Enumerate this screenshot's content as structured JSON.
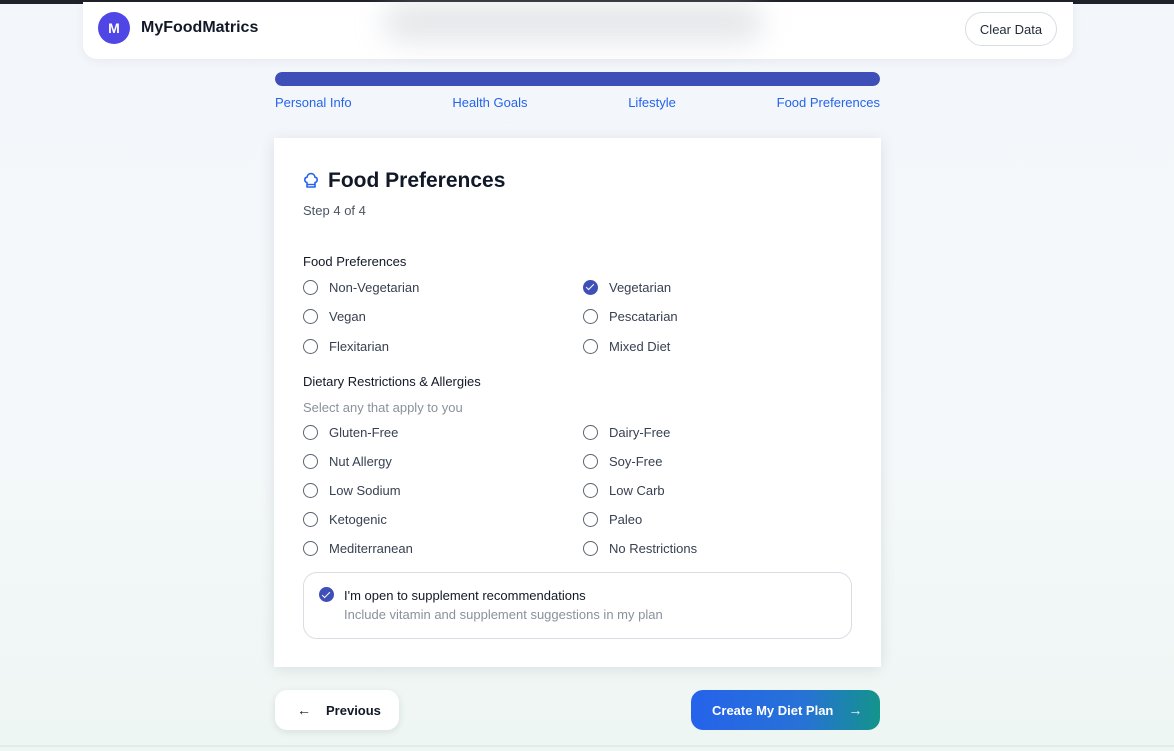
{
  "header": {
    "logo_letter": "M",
    "brand": "MyFoodMatrics",
    "clear_label": "Clear Data"
  },
  "progress": {
    "fraction": 1.0,
    "steps": [
      "Personal Info",
      "Health Goals",
      "Lifestyle",
      "Food Preferences"
    ]
  },
  "card": {
    "icon": "chef-hat-icon",
    "title": "Food Preferences",
    "subtitle": "Step 4 of 4",
    "preferences_title": "Food Preferences",
    "preferences": [
      {
        "label": "Non-Vegetarian",
        "checked": false
      },
      {
        "label": "Vegetarian",
        "checked": true
      },
      {
        "label": "Vegan",
        "checked": false
      },
      {
        "label": "Pescatarian",
        "checked": false
      },
      {
        "label": "Flexitarian",
        "checked": false
      },
      {
        "label": "Mixed Diet",
        "checked": false
      }
    ],
    "restrictions_title": "Dietary Restrictions & Allergies",
    "restrictions_hint": "Select any that apply to you",
    "restrictions": [
      {
        "label": "Gluten-Free",
        "checked": false
      },
      {
        "label": "Dairy-Free",
        "checked": false
      },
      {
        "label": "Nut Allergy",
        "checked": false
      },
      {
        "label": "Soy-Free",
        "checked": false
      },
      {
        "label": "Low Sodium",
        "checked": false
      },
      {
        "label": "Low Carb",
        "checked": false
      },
      {
        "label": "Ketogenic",
        "checked": false
      },
      {
        "label": "Paleo",
        "checked": false
      },
      {
        "label": "Mediterranean",
        "checked": false
      },
      {
        "label": "No Restrictions",
        "checked": false
      }
    ],
    "supplement": {
      "checked": true,
      "label": "I'm open to supplement recommendations",
      "description": "Include vitamin and supplement suggestions in my plan"
    }
  },
  "nav": {
    "prev_label": "Previous",
    "prev_icon": "arrow-left-icon",
    "next_label": "Create My Diet Plan",
    "next_icon": "arrow-right-icon"
  },
  "colors": {
    "accent": "#3f4fb8",
    "brand_badge": "#4f46e5",
    "link": "#2563eb",
    "cta_start": "#2563eb",
    "cta_end": "#13948a"
  }
}
